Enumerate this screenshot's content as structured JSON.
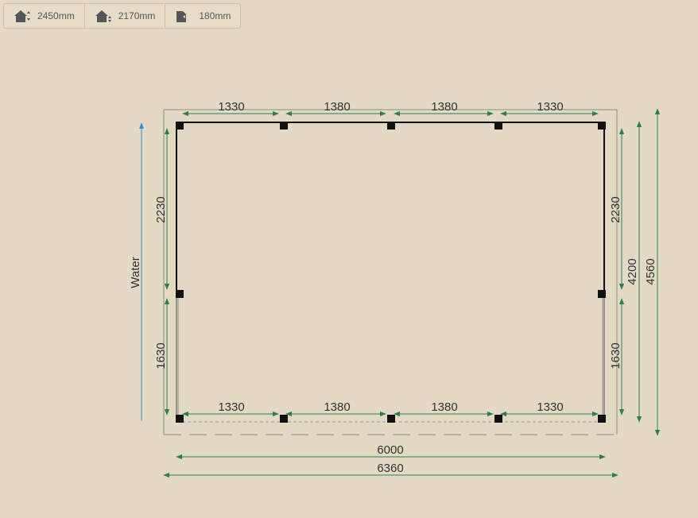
{
  "toolbar": {
    "items": [
      {
        "icon": "roof-height-icon",
        "value": "2450mm"
      },
      {
        "icon": "wall-height-icon",
        "value": "2170mm"
      },
      {
        "icon": "overhang-icon",
        "value": "180mm"
      }
    ]
  },
  "plan": {
    "water_label": "Water",
    "top_segments": [
      "1330",
      "1380",
      "1380",
      "1330"
    ],
    "bottom_segments": [
      "1330",
      "1380",
      "1380",
      "1330"
    ],
    "left_segments": [
      "2230",
      "1630"
    ],
    "right_segments": [
      "2230",
      "1630"
    ],
    "inner_width": "6000",
    "outer_width": "6360",
    "inner_depth": "4200",
    "outer_depth": "4560"
  },
  "colors": {
    "dimension_line": "#2e7d4f",
    "water_arrow": "#3a8fd0",
    "wall": "#111111",
    "background": "#e3d9c4"
  }
}
